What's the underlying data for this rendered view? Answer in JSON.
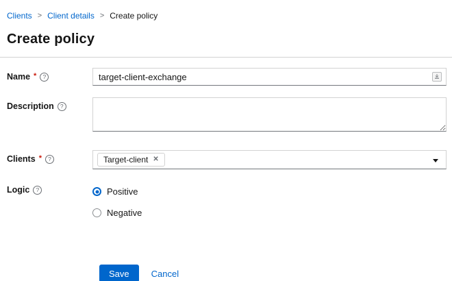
{
  "breadcrumb": {
    "items": [
      {
        "label": "Clients",
        "current": false
      },
      {
        "label": "Client details",
        "current": false
      },
      {
        "label": "Create policy",
        "current": true
      }
    ],
    "separator": ">"
  },
  "page": {
    "title": "Create policy"
  },
  "form": {
    "required_indicator": "*",
    "name": {
      "label": "Name",
      "required": true,
      "value": "target-client-exchange"
    },
    "description": {
      "label": "Description",
      "required": false,
      "value": "",
      "placeholder": ""
    },
    "clients": {
      "label": "Clients",
      "required": true,
      "chips": [
        {
          "label": "Target-client"
        }
      ]
    },
    "logic": {
      "label": "Logic",
      "options": [
        {
          "label": "Positive",
          "selected": true
        },
        {
          "label": "Negative",
          "selected": false
        }
      ]
    },
    "actions": {
      "save_label": "Save",
      "cancel_label": "Cancel"
    }
  },
  "icons": {
    "help_icon": "?",
    "remove_chip_icon": "✕"
  },
  "colors": {
    "accent": "#0066cc",
    "required": "#c9190b",
    "text": "#151515",
    "border": "#d2d2d2",
    "border_bottom": "#72767b",
    "icon_gray": "#6a6e73"
  }
}
